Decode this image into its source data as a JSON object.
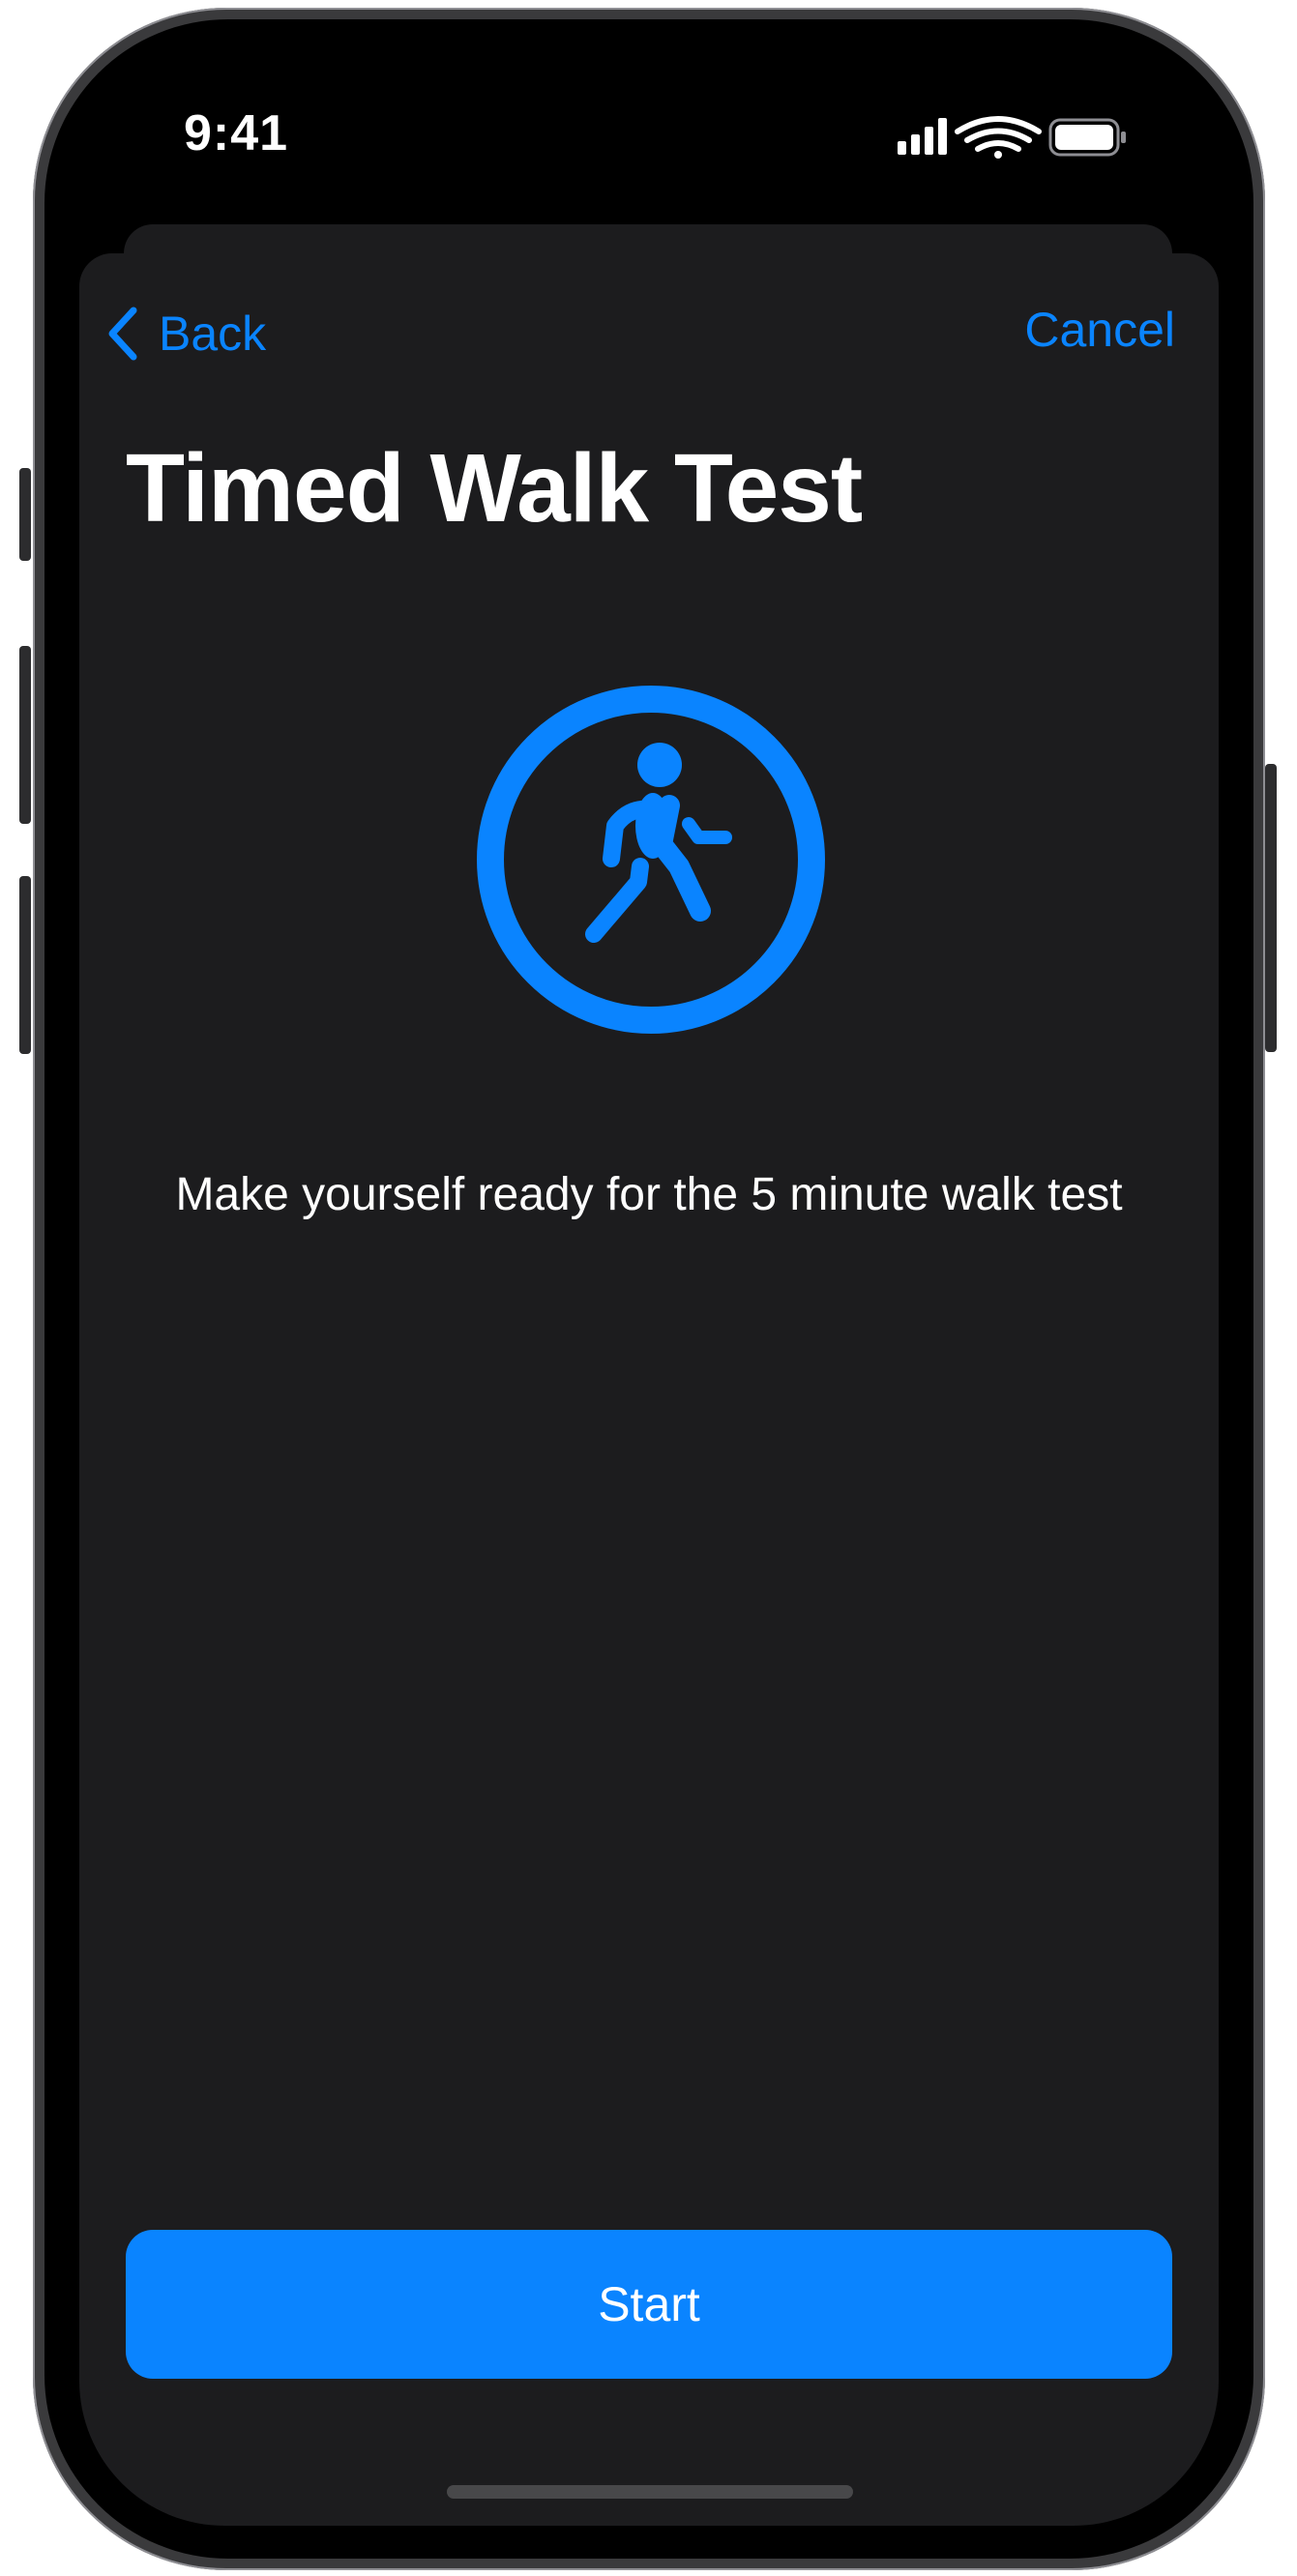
{
  "status_bar": {
    "time": "9:41"
  },
  "nav": {
    "back_label": "Back",
    "cancel_label": "Cancel"
  },
  "page": {
    "title": "Timed Walk Test",
    "instruction": "Make yourself ready for the 5 minute walk test"
  },
  "actions": {
    "start_label": "Start"
  },
  "icons": {
    "hero": "figure-walk-circle-icon",
    "back": "chevron-left-icon"
  },
  "colors": {
    "accent": "#0a84ff",
    "sheet_background": "#1c1c1e",
    "text_primary": "#ffffff"
  }
}
